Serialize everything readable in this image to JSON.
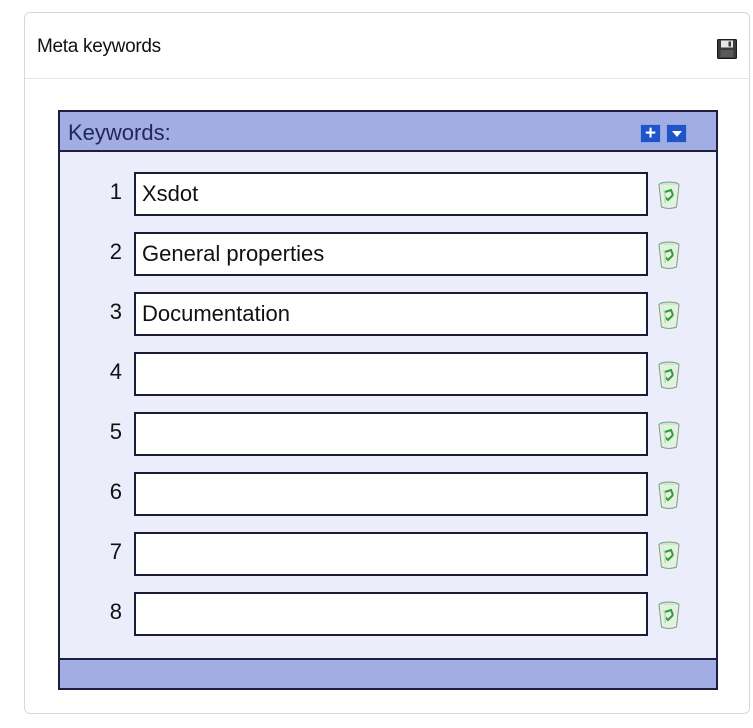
{
  "panel": {
    "title": "Meta keywords",
    "save_icon": "floppy-disk-icon"
  },
  "keywords": {
    "label": "Keywords:",
    "add_icon": "plus-icon",
    "menu_icon": "chevron-down-icon",
    "rows": [
      {
        "number": "1",
        "value": "Xsdot"
      },
      {
        "number": "2",
        "value": "General properties"
      },
      {
        "number": "3",
        "value": "Documentation"
      },
      {
        "number": "4",
        "value": ""
      },
      {
        "number": "5",
        "value": ""
      },
      {
        "number": "6",
        "value": ""
      },
      {
        "number": "7",
        "value": ""
      },
      {
        "number": "8",
        "value": ""
      }
    ],
    "delete_icon": "recycle-bin-icon"
  },
  "colors": {
    "header_bar": "#a2ade3",
    "box_background": "#ebedfa",
    "button_blue": "#1f55c9",
    "border_dark": "#1e1e3e"
  }
}
